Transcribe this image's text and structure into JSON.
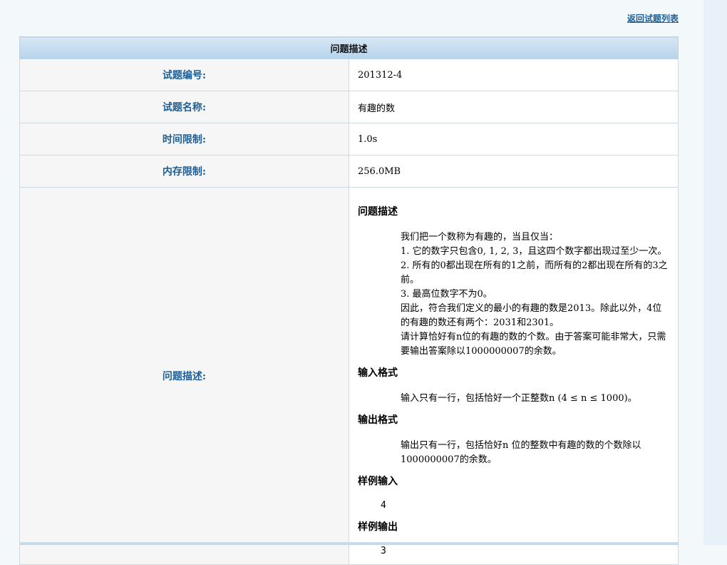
{
  "header": {
    "back_link": "返回试题列表"
  },
  "table": {
    "heading": "问题描述",
    "rows": [
      {
        "label": "试题编号:",
        "value": "201312-4"
      },
      {
        "label": "试题名称:",
        "value": "有趣的数"
      },
      {
        "label": "时间限制:",
        "value": "1.0s"
      },
      {
        "label": "内存限制:",
        "value": "256.0MB"
      }
    ],
    "desc_label": "问题描述:"
  },
  "problem": {
    "description_title": "问题描述",
    "description_lines": [
      "我们把一个数称为有趣的，当且仅当：",
      "1. 它的数字只包含0, 1, 2, 3，且这四个数字都出现过至少一次。",
      "2. 所有的0都出现在所有的1之前，而所有的2都出现在所有的3之前。",
      "3. 最高位数字不为0。",
      "因此，符合我们定义的最小的有趣的数是2013。除此以外，4位的有趣的数还有两个：2031和2301。",
      "请计算恰好有n位的有趣的数的个数。由于答案可能非常大，只需要输出答案除以1000000007的余数。"
    ],
    "input_title": "输入格式",
    "input_text": "输入只有一行，包括恰好一个正整数n (4 ≤ n ≤ 1000)。",
    "output_title": "输出格式",
    "output_text": "输出只有一行，包括恰好n 位的整数中有趣的数的个数除以1000000007的余数。",
    "sample_input_title": "样例输入",
    "sample_input": "4",
    "sample_output_title": "样例输出",
    "sample_output": "3"
  }
}
